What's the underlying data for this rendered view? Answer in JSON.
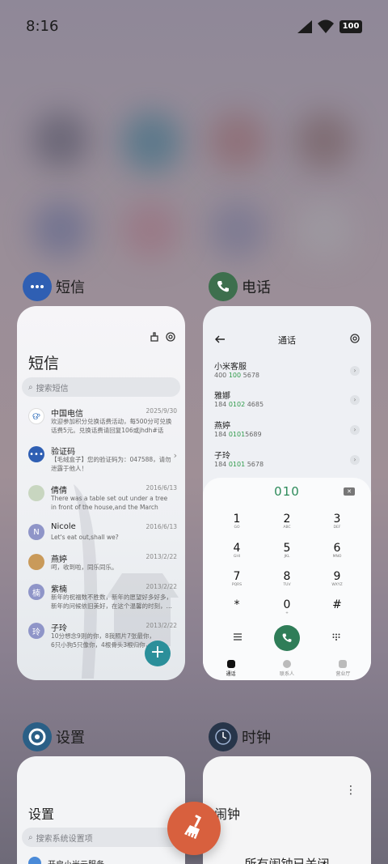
{
  "status": {
    "time": "8:16",
    "battery": "100"
  },
  "apps": {
    "sms": {
      "label": "短信",
      "title": "短信",
      "search_placeholder": "搜索短信",
      "messages": [
        {
          "name": "中国电信",
          "date": "2025/9/30",
          "preview": "欢迎参加积分兑换话费活动，每500分可兑换话费5元。兑换话费请回复106或jhdh#话费…",
          "avatar": "telecom-logo"
        },
        {
          "name": "验证码",
          "date": "",
          "preview": "【毛绒盒子】您的验证码为：047588，请勿泄露于他人！",
          "avatar": "chat-icon"
        },
        {
          "name": "倩倩",
          "date": "2016/6/13",
          "preview": "There was a table set out under a tree in front of the house,and the March Hare an…",
          "avatar": "photo"
        },
        {
          "name": "Nicole",
          "date": "2016/6/13",
          "preview": "Let's eat out,shall we?",
          "avatar": "N"
        },
        {
          "name": "燕婷",
          "date": "2013/2/22",
          "preview": "呵，收到啦，同乐同乐。",
          "avatar": "photo"
        },
        {
          "name": "紫楠",
          "date": "2013/2/22",
          "preview": "新年的祝福数不胜数，新年的愿望好多好多，新年的问候依旧美好，在这个温馨的时刻，…",
          "avatar": "楠"
        },
        {
          "name": "子玲",
          "date": "2013/2/22",
          "preview": "10分想念9则的你，8我照片7张最你，6只小狗5只像你，4根骨头3根归你，2爪和…",
          "avatar": "玲"
        }
      ],
      "fab": "+"
    },
    "phone": {
      "label": "电话",
      "title": "通话",
      "contacts": [
        {
          "name": "小米客服",
          "num_pre": "400 ",
          "num_hl": "100",
          "num_post": " 5678"
        },
        {
          "name": "雅娜",
          "num_pre": "184 ",
          "num_hl": "0102",
          "num_post": " 4685"
        },
        {
          "name": "燕婷",
          "num_pre": "184 ",
          "num_hl": "0101",
          "num_post": "5689"
        },
        {
          "name": "子玲",
          "num_pre": "184 ",
          "num_hl": "0101",
          "num_post": " 5678"
        }
      ],
      "dialed": "010",
      "keys": [
        {
          "d": "1",
          "l": "GO"
        },
        {
          "d": "2",
          "l": "ABC"
        },
        {
          "d": "3",
          "l": "DEF"
        },
        {
          "d": "4",
          "l": "GHI"
        },
        {
          "d": "5",
          "l": "JKL"
        },
        {
          "d": "6",
          "l": "MNO"
        },
        {
          "d": "7",
          "l": "PQRS"
        },
        {
          "d": "8",
          "l": "TUV"
        },
        {
          "d": "9",
          "l": "WXYZ"
        },
        {
          "d": "*",
          "l": ""
        },
        {
          "d": "0",
          "l": "+"
        },
        {
          "d": "#",
          "l": ""
        }
      ],
      "tabs": [
        "通话",
        "联系人",
        "营业厅"
      ]
    },
    "settings": {
      "label": "设置",
      "title": "设置",
      "search_placeholder": "搜索系统设置项",
      "item": "开启小米云服务"
    },
    "clock": {
      "label": "时钟",
      "title": "闹钟",
      "subtitle": "所有闹钟已关闭"
    }
  },
  "colors": {
    "fab": "#2b8f9a",
    "call": "#2f7d58",
    "cleaner": "#d8603e",
    "digit_highlight": "#2f9a4a"
  }
}
